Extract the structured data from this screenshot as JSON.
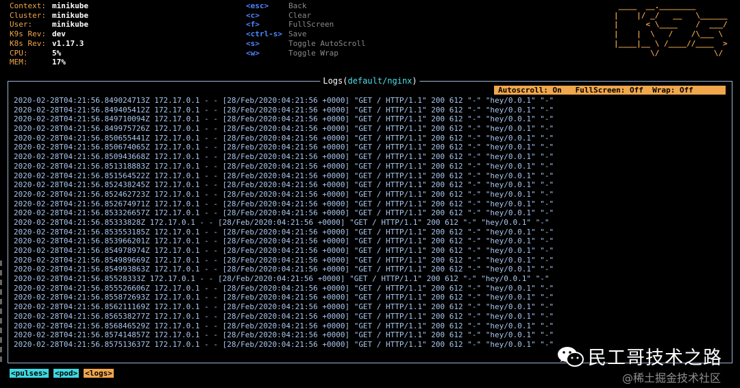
{
  "info": [
    {
      "label": "Context:",
      "value": "minikube"
    },
    {
      "label": "Cluster:",
      "value": "minikube"
    },
    {
      "label": "User:",
      "value": "minikube"
    },
    {
      "label": "K9s Rev:",
      "value": "dev"
    },
    {
      "label": "K8s Rev:",
      "value": "v1.17.3"
    },
    {
      "label": "CPU:",
      "value": "5%"
    },
    {
      "label": "MEM:",
      "value": "17%"
    }
  ],
  "hints": [
    {
      "key": "<esc>",
      "desc": "Back"
    },
    {
      "key": "<c>",
      "desc": "Clear"
    },
    {
      "key": "<f>",
      "desc": "FullScreen"
    },
    {
      "key": "<ctrl-s>",
      "desc": "Save"
    },
    {
      "key": "<s>",
      "desc": "Toggle AutoScroll"
    },
    {
      "key": "<w>",
      "desc": "Toggle Wrap"
    }
  ],
  "logo": " ____  __.________        \n|    |/ _/   __   \\______ \n|      < \\____    /  ___/ \n|    |  \\   /    /\\___ \\  \n|____|__ \\ /____//____  > \n        \\/            \\/  ",
  "panel": {
    "title_prefix": "Logs(",
    "title_ns": "default/nginx",
    "title_suffix": ")",
    "status": "Autoscroll: On   FullScreen: Off  Wrap: Off"
  },
  "logs": [
    "2020-02-28T04:21:56.849024713Z 172.17.0.1 - - [28/Feb/2020:04:21:56 +0000] \"GET / HTTP/1.1\" 200 612 \"-\" \"hey/0.0.1\" \"-\"",
    "2020-02-28T04:21:56.849405412Z 172.17.0.1 - - [28/Feb/2020:04:21:56 +0000] \"GET / HTTP/1.1\" 200 612 \"-\" \"hey/0.0.1\" \"-\"",
    "2020-02-28T04:21:56.849710094Z 172.17.0.1 - - [28/Feb/2020:04:21:56 +0000] \"GET / HTTP/1.1\" 200 612 \"-\" \"hey/0.0.1\" \"-\"",
    "2020-02-28T04:21:56.849975726Z 172.17.0.1 - - [28/Feb/2020:04:21:56 +0000] \"GET / HTTP/1.1\" 200 612 \"-\" \"hey/0.0.1\" \"-\"",
    "2020-02-28T04:21:56.850655441Z 172.17.0.1 - - [28/Feb/2020:04:21:56 +0000] \"GET / HTTP/1.1\" 200 612 \"-\" \"hey/0.0.1\" \"-\"",
    "2020-02-28T04:21:56.850674065Z 172.17.0.1 - - [28/Feb/2020:04:21:56 +0000] \"GET / HTTP/1.1\" 200 612 \"-\" \"hey/0.0.1\" \"-\"",
    "2020-02-28T04:21:56.850943668Z 172.17.0.1 - - [28/Feb/2020:04:21:56 +0000] \"GET / HTTP/1.1\" 200 612 \"-\" \"hey/0.0.1\" \"-\"",
    "2020-02-28T04:21:56.851318883Z 172.17.0.1 - - [28/Feb/2020:04:21:56 +0000] \"GET / HTTP/1.1\" 200 612 \"-\" \"hey/0.0.1\" \"-\"",
    "2020-02-28T04:21:56.851564522Z 172.17.0.1 - - [28/Feb/2020:04:21:56 +0000] \"GET / HTTP/1.1\" 200 612 \"-\" \"hey/0.0.1\" \"-\"",
    "2020-02-28T04:21:56.852438245Z 172.17.0.1 - - [28/Feb/2020:04:21:56 +0000] \"GET / HTTP/1.1\" 200 612 \"-\" \"hey/0.0.1\" \"-\"",
    "2020-02-28T04:21:56.852462723Z 172.17.0.1 - - [28/Feb/2020:04:21:56 +0000] \"GET / HTTP/1.1\" 200 612 \"-\" \"hey/0.0.1\" \"-\"",
    "2020-02-28T04:21:56.852674971Z 172.17.0.1 - - [28/Feb/2020:04:21:56 +0000] \"GET / HTTP/1.1\" 200 612 \"-\" \"hey/0.0.1\" \"-\"",
    "2020-02-28T04:21:56.853326657Z 172.17.0.1 - - [28/Feb/2020:04:21:56 +0000] \"GET / HTTP/1.1\" 200 612 \"-\" \"hey/0.0.1\" \"-\"",
    "2020-02-28T04:21:56.85333828Z 172.17.0.1 - - [28/Feb/2020:04:21:56 +0000] \"GET / HTTP/1.1\" 200 612 \"-\" \"hey/0.0.1\" \"-\"",
    "2020-02-28T04:21:56.853553185Z 172.17.0.1 - - [28/Feb/2020:04:21:56 +0000] \"GET / HTTP/1.1\" 200 612 \"-\" \"hey/0.0.1\" \"-\"",
    "2020-02-28T04:21:56.853966201Z 172.17.0.1 - - [28/Feb/2020:04:21:56 +0000] \"GET / HTTP/1.1\" 200 612 \"-\" \"hey/0.0.1\" \"-\"",
    "2020-02-28T04:21:56.854978974Z 172.17.0.1 - - [28/Feb/2020:04:21:56 +0000] \"GET / HTTP/1.1\" 200 612 \"-\" \"hey/0.0.1\" \"-\"",
    "2020-02-28T04:21:56.854989669Z 172.17.0.1 - - [28/Feb/2020:04:21:56 +0000] \"GET / HTTP/1.1\" 200 612 \"-\" \"hey/0.0.1\" \"-\"",
    "2020-02-28T04:21:56.854993863Z 172.17.0.1 - - [28/Feb/2020:04:21:56 +0000] \"GET / HTTP/1.1\" 200 612 \"-\" \"hey/0.0.1\" \"-\"",
    "2020-02-28T04:21:56.85528333Z 172.17.0.1 - - [28/Feb/2020:04:21:56 +0000] \"GET / HTTP/1.1\" 200 612 \"-\" \"hey/0.0.1\" \"-\"",
    "2020-02-28T04:21:56.855526606Z 172.17.0.1 - - [28/Feb/2020:04:21:56 +0000] \"GET / HTTP/1.1\" 200 612 \"-\" \"hey/0.0.1\" \"-\"",
    "2020-02-28T04:21:56.855872693Z 172.17.0.1 - - [28/Feb/2020:04:21:56 +0000] \"GET / HTTP/1.1\" 200 612 \"-\" \"hey/0.0.1\" \"-\"",
    "2020-02-28T04:21:56.856211169Z 172.17.0.1 - - [28/Feb/2020:04:21:56 +0000] \"GET / HTTP/1.1\" 200 612 \"-\" \"hey/0.0.1\" \"-\"",
    "2020-02-28T04:21:56.856538277Z 172.17.0.1 - - [28/Feb/2020:04:21:56 +0000] \"GET / HTTP/1.1\" 200 612 \"-\" \"hey/0.0.1\" \"-\"",
    "2020-02-28T04:21:56.856846529Z 172.17.0.1 - - [28/Feb/2020:04:21:56 +0000] \"GET / HTTP/1.1\" 200 612 \"-\" \"hey/0.0.1\" \"-\"",
    "2020-02-28T04:21:56.857414857Z 172.17.0.1 - - [28/Feb/2020:04:21:56 +0000] \"GET / HTTP/1.1\" 200 612 \"-\" \"hey/0.0.1\" \"-\"",
    "2020-02-28T04:21:56.857513637Z 172.17.0.1 - - [28/Feb/2020:04:21:56 +0000] \"GET / HTTP/1.1\" 200 612 \"-\" \"hey/0.0.1\" \"-\""
  ],
  "crumbs": [
    {
      "label": "<pulses>",
      "color": "#3fd8e0"
    },
    {
      "label": "<pod>",
      "color": "#3fd8e0"
    },
    {
      "label": "<logs>",
      "color": "#f0a64b"
    }
  ],
  "watermark": {
    "text": "民工哥技术之路",
    "icon": "wechat-icon",
    "sub": "@稀土掘金技术社区"
  },
  "colors": {
    "accent_orange": "#f0a64b",
    "key_blue": "#4f86ff",
    "log_text": "#a9c7f0",
    "cyan": "#3fd8e0"
  }
}
